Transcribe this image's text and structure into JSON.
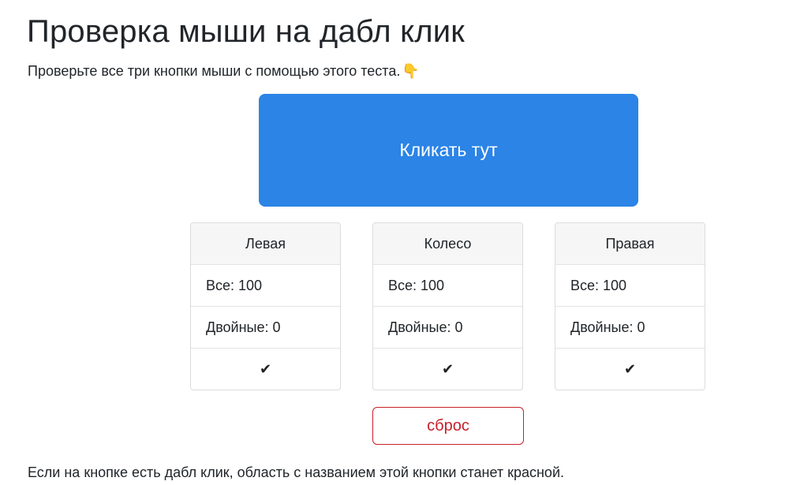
{
  "page": {
    "title": "Проверка мыши на дабл клик",
    "subtitle": "Проверьте все три кнопки мыши с помощью этого теста.",
    "subtitle_icon": "👇",
    "click_area_label": "Кликать тут",
    "reset_label": "сброс",
    "footer_note": "Если на кнопке есть дабл клик, область с названием этой кнопки станет красной."
  },
  "buttons": [
    {
      "name": "Левая",
      "total": "Все: 100",
      "doubles": "Двойные: 0",
      "status_icon": "✔"
    },
    {
      "name": "Колесо",
      "total": "Все: 100",
      "doubles": "Двойные: 0",
      "status_icon": "✔"
    },
    {
      "name": "Правая",
      "total": "Все: 100",
      "doubles": "Двойные: 0",
      "status_icon": "✔"
    }
  ],
  "colors": {
    "click_area": "#2b84e6",
    "reset_border": "#c8202a",
    "header_bg": "#f6f6f6"
  }
}
